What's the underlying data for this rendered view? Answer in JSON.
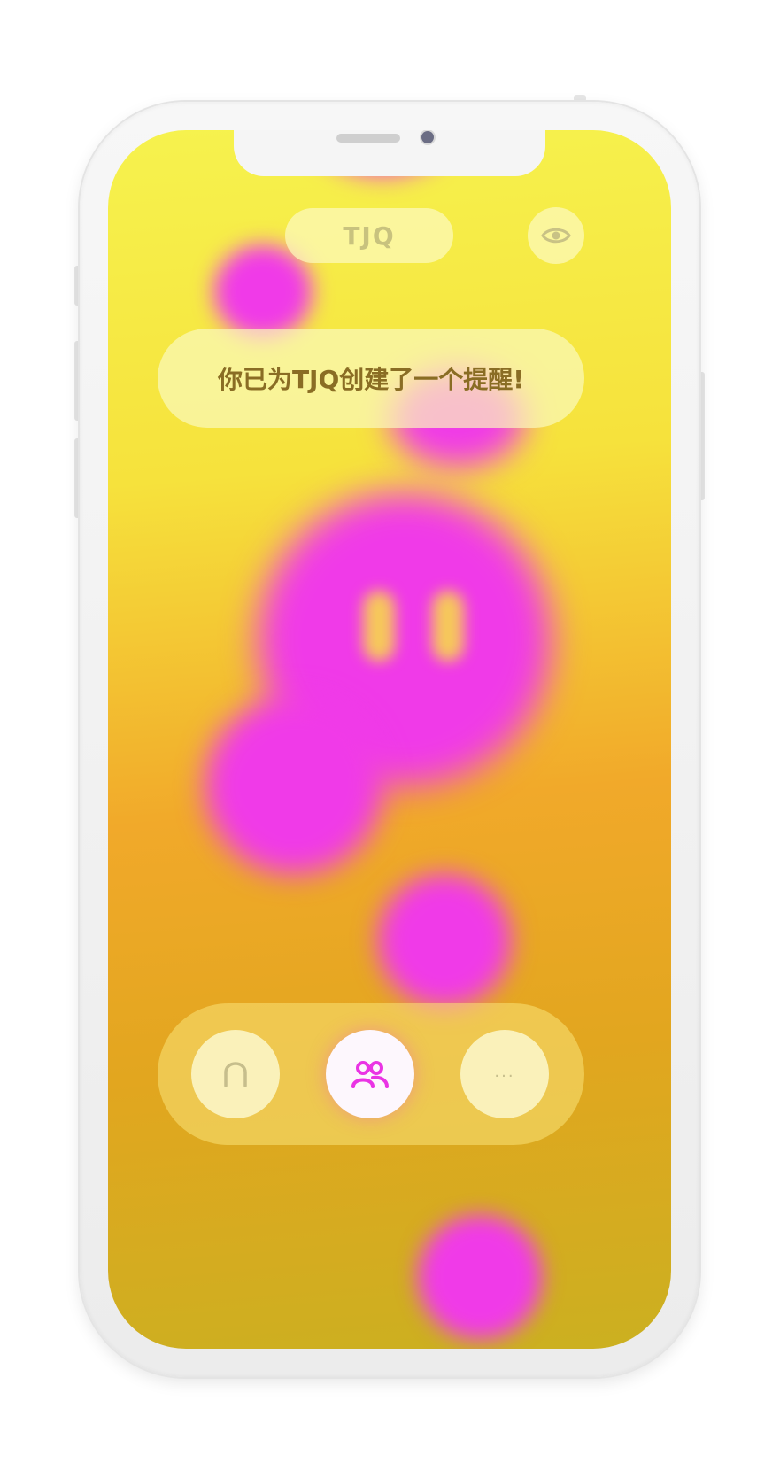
{
  "header": {
    "name_label": "TJQ",
    "visibility_icon": "eye-icon"
  },
  "notification": {
    "message": "你已为TJQ创建了一个提醒!"
  },
  "bottom_nav": {
    "items": [
      {
        "icon": "home-icon",
        "active": false
      },
      {
        "icon": "friends-icon",
        "active": true
      },
      {
        "icon": "more-icon",
        "label": "...",
        "active": false
      }
    ]
  },
  "colors": {
    "accent": "#f03ae8",
    "background_top": "#f6f24e",
    "background_bottom": "#cbb020",
    "notice_text": "#8a6d24"
  }
}
